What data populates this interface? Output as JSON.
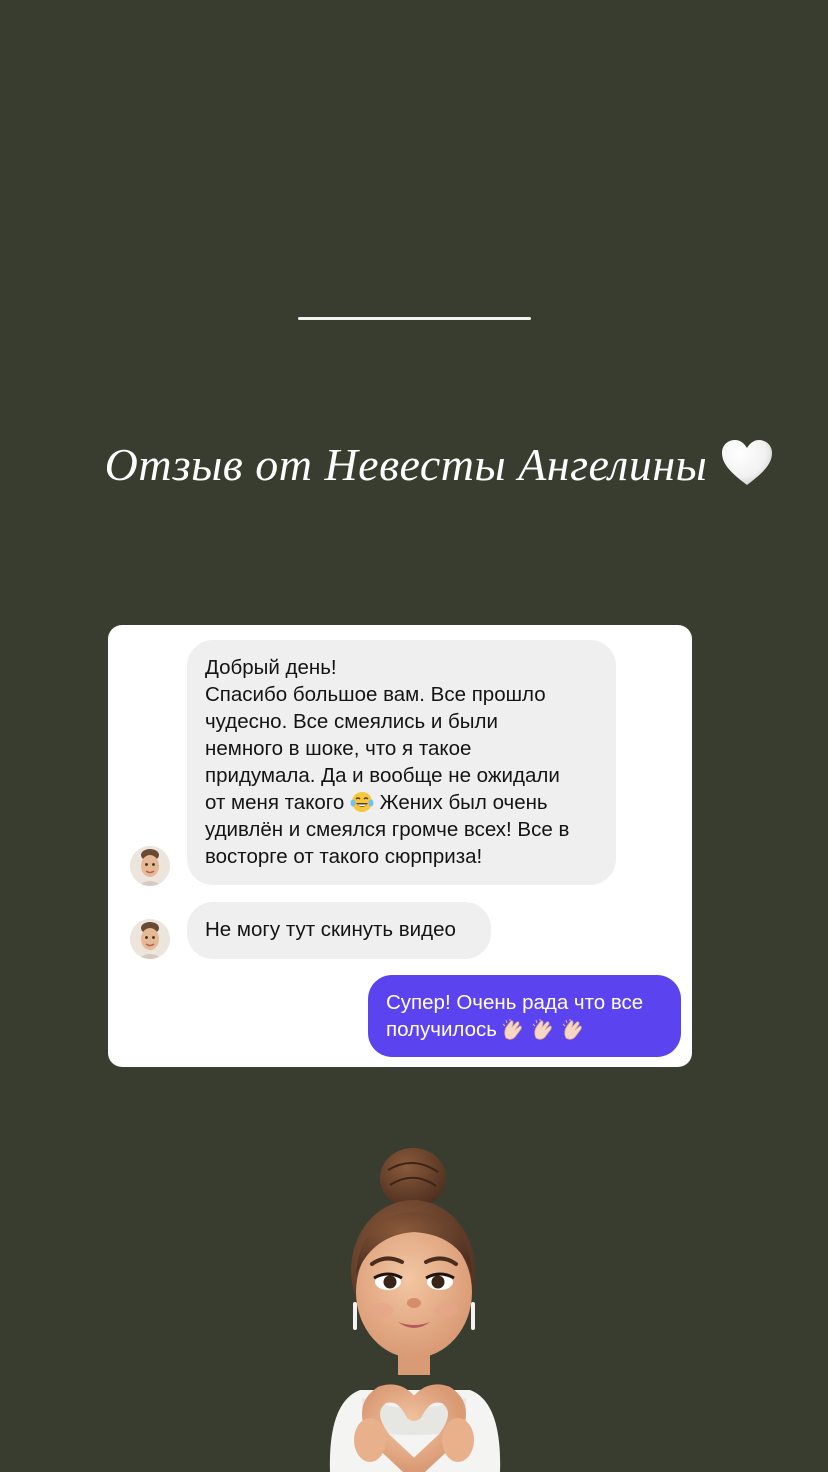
{
  "story": {
    "title": "Отзыв от Невесты Ангелины",
    "title_emoji": "white-heart-icon",
    "background_color": "#393d2f"
  },
  "chat": {
    "messages": [
      {
        "direction": "incoming",
        "text_lines_1": "Добрый день!\nСпасибо большое вам. Все прошло\nчудесно. Все смеялись и были\nнемного в шоке, что я такое\nпридумала. Да и вообще не ожидали\nот меня такого",
        "emoji": "laughing-tears-emoji",
        "text_lines_2": " Жених был очень\nудивлён и смеялся громче всех! Все в\nвосторге от такого сюрприза!"
      },
      {
        "direction": "incoming",
        "text": "Не могу тут скинуть видео"
      },
      {
        "direction": "outgoing",
        "text": "Супер! Очень рада что все\nполучилось",
        "emojis": [
          "clapping-hands-emoji",
          "clapping-hands-emoji",
          "clapping-hands-emoji"
        ],
        "bubble_color": "#5b43f0"
      }
    ]
  },
  "sticker": "bride-memoji-heart-hands"
}
